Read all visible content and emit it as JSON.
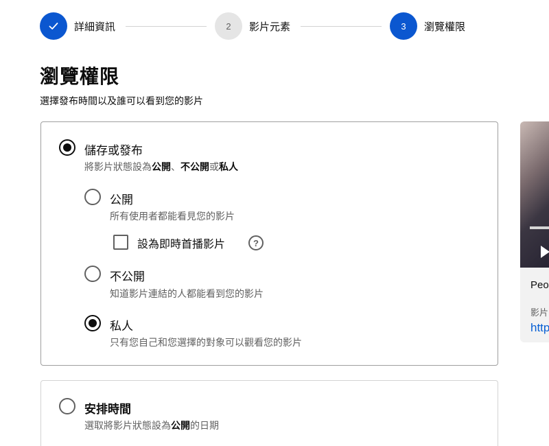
{
  "stepper": {
    "steps": [
      {
        "number": "",
        "label": "詳細資訊",
        "state": "done",
        "icon": "check-icon"
      },
      {
        "number": "2",
        "label": "影片元素",
        "state": "todo"
      },
      {
        "number": "3",
        "label": "瀏覽權限",
        "state": "current"
      }
    ]
  },
  "page": {
    "title": "瀏覽權限",
    "subtitle": "選擇發布時間以及誰可以看到您的影片"
  },
  "save_publish": {
    "title": "儲存或發布",
    "desc_prefix": "將影片狀態設為",
    "desc_public": "公開",
    "desc_sep": "、",
    "desc_unlisted": "不公開",
    "desc_or": "或",
    "desc_private": "私人",
    "selected": true,
    "options": [
      {
        "title": "公開",
        "desc": "所有使用者都能看見您的影片",
        "selected": false
      },
      {
        "title": "不公開",
        "desc": "知道影片連結的人都能看到您的影片",
        "selected": false
      },
      {
        "title": "私人",
        "desc": "只有您自己和您選擇的對象可以觀看您的影片",
        "selected": true
      }
    ],
    "premiere_checkbox": {
      "label": "設為即時首播影片",
      "checked": false,
      "help_icon": "question-mark-icon",
      "help_glyph": "?"
    }
  },
  "schedule": {
    "title": "安排時間",
    "desc_prefix": "選取將影片狀態設為",
    "desc_public": "公開",
    "desc_suffix": "的日期",
    "selected": false
  },
  "preview": {
    "title": "Peo",
    "link_label": "影片",
    "link": "http"
  },
  "colors": {
    "accent": "#0b57d0",
    "link": "#065fd4",
    "muted_text": "#606060"
  }
}
